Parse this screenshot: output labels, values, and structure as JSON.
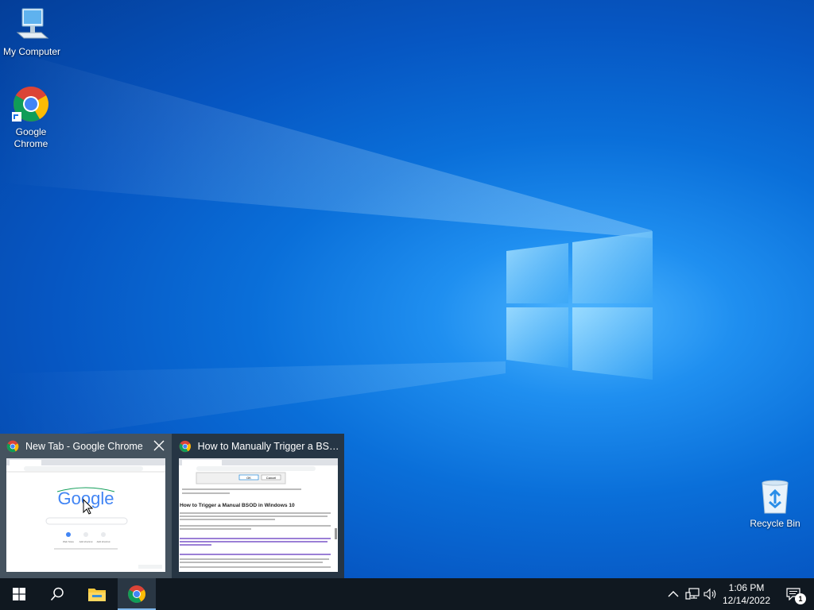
{
  "desktop": {
    "icons": [
      {
        "label": "My Computer",
        "icon": "computer-icon"
      },
      {
        "label": "Google Chrome",
        "label_line1": "Google",
        "label_line2": "Chrome",
        "icon": "chrome-icon"
      },
      {
        "label": "Recycle Bin",
        "icon": "recycle-bin-icon"
      }
    ]
  },
  "thumbnails": [
    {
      "title": "New Tab - Google Chrome",
      "preview": {
        "logo": "Google",
        "shortcuts": [
          "Web Store",
          "Add shortcut",
          "Add shortcut"
        ]
      }
    },
    {
      "title": "How to Manually Trigger a BSO...",
      "preview": {
        "dialog_ok": "OK",
        "dialog_cancel": "Cancel",
        "heading": "How to Trigger a Manual BSOD in Windows 10"
      }
    }
  ],
  "taskbar": {
    "clock_time": "1:06 PM",
    "clock_date": "12/14/2022",
    "notification_count": "1"
  },
  "colors": {
    "taskbar_bg": "#101820",
    "accent": "#0a6fd9"
  }
}
